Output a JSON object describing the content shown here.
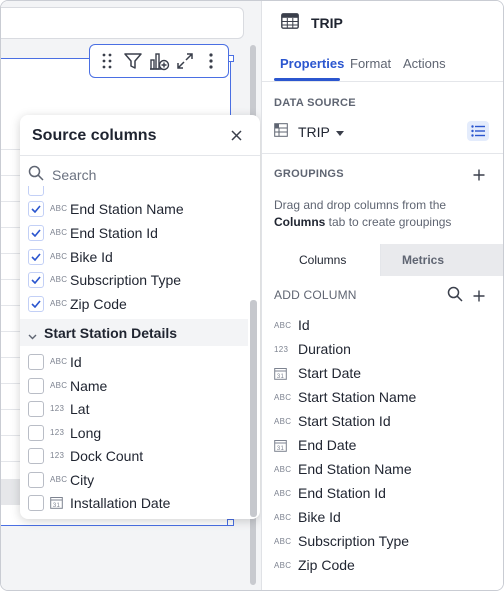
{
  "popup": {
    "title": "Source columns",
    "search_placeholder": "Search",
    "checked_items": [
      {
        "type": "ABC",
        "label": "End Station Name"
      },
      {
        "type": "ABC",
        "label": "End Station Id"
      },
      {
        "type": "ABC",
        "label": "Bike Id"
      },
      {
        "type": "ABC",
        "label": "Subscription Type"
      },
      {
        "type": "ABC",
        "label": "Zip Code"
      }
    ],
    "group_label": "Start Station Details",
    "group_items": [
      {
        "type": "ABC",
        "label": "Id"
      },
      {
        "type": "ABC",
        "label": "Name"
      },
      {
        "type": "123",
        "label": "Lat"
      },
      {
        "type": "123",
        "label": "Long"
      },
      {
        "type": "123",
        "label": "Dock Count"
      },
      {
        "type": "ABC",
        "label": "City"
      },
      {
        "type": "date",
        "label": "Installation Date"
      }
    ]
  },
  "panel": {
    "title": "TRIP",
    "tabs": [
      "Properties",
      "Format",
      "Actions"
    ],
    "data_source_label": "DATA SOURCE",
    "data_source_name": "TRIP",
    "groupings_label": "GROUPINGS",
    "hint_prefix": "Drag and drop columns from the ",
    "hint_bold": "Columns",
    "hint_suffix": " tab to create groupings",
    "segments": [
      "Columns",
      "Metrics"
    ],
    "add_column_label": "ADD COLUMN",
    "columns": [
      {
        "type": "ABC",
        "label": "Id"
      },
      {
        "type": "123",
        "label": "Duration"
      },
      {
        "type": "date",
        "label": "Start Date"
      },
      {
        "type": "ABC",
        "label": "Start Station Name"
      },
      {
        "type": "ABC",
        "label": "Start Station Id"
      },
      {
        "type": "date",
        "label": "End Date"
      },
      {
        "type": "ABC",
        "label": "End Station Name"
      },
      {
        "type": "ABC",
        "label": "End Station Id"
      },
      {
        "type": "ABC",
        "label": "Bike Id"
      },
      {
        "type": "ABC",
        "label": "Subscription Type"
      },
      {
        "type": "ABC",
        "label": "Zip Code"
      }
    ]
  },
  "colors": {
    "accent": "#2b56cf",
    "selection": "#4a6fe3"
  }
}
